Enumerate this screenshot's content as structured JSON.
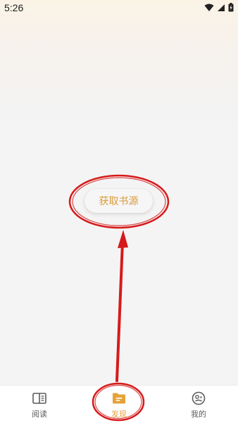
{
  "status_bar": {
    "time": "5:26",
    "icons": [
      "wifi-icon",
      "cell-signal-icon",
      "battery-charging-icon"
    ]
  },
  "main": {
    "fetch_button_label": "获取书源"
  },
  "bottom_nav": {
    "items": [
      {
        "label": "阅读",
        "icon": "book-icon",
        "active": false
      },
      {
        "label": "发现",
        "icon": "folder-icon",
        "active": true
      },
      {
        "label": "我的",
        "icon": "profile-icon",
        "active": false
      }
    ]
  },
  "colors": {
    "accent": "#e5a23a",
    "annotation_red": "#d61a1a",
    "nav_text": "#5c5c5c"
  }
}
